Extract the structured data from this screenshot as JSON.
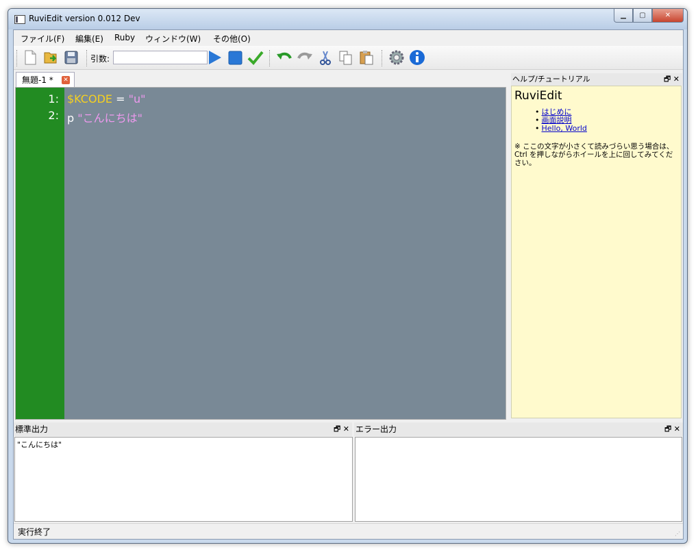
{
  "window": {
    "title": "RuviEdit version 0.012 Dev",
    "controls": {
      "minimize": "▁",
      "maximize": "▢",
      "close": "✕"
    }
  },
  "menu": {
    "items": [
      {
        "label": "ファイル(F)"
      },
      {
        "label": "編集(E)"
      },
      {
        "label": "Ruby"
      },
      {
        "label": "ウィンドウ(W)"
      },
      {
        "label": "その他(O)"
      }
    ]
  },
  "toolbar": {
    "buttons": [
      "new-file-icon",
      "open-folder-icon",
      "save-disk-icon",
      "run-play-icon",
      "stop-square-icon",
      "check-syntax-icon",
      "undo-icon",
      "redo-icon",
      "cut-scissors-icon",
      "copy-icon",
      "paste-icon",
      "settings-gear-icon",
      "info-icon"
    ],
    "args_label": "引数:",
    "args_value": ""
  },
  "editor": {
    "tab_label": "無題-1 *",
    "tab_close": "✕",
    "line_numbers": [
      "1:",
      "2:"
    ],
    "lines": [
      [
        {
          "text": "$KCODE",
          "kind": "var"
        },
        {
          "text": " = ",
          "kind": "op"
        },
        {
          "text": "\"u\"",
          "kind": "str"
        }
      ],
      [
        {
          "text": "p ",
          "kind": "op"
        },
        {
          "text": "\"こんにちは\"",
          "kind": "str"
        }
      ]
    ],
    "colors": {
      "background": "#798996",
      "gutter": "#228b22",
      "variable": "#f5d020",
      "string": "#ee99ee"
    }
  },
  "help": {
    "header": "ヘルプ/チュートリアル",
    "dock_float": "🗗",
    "dock_close": "✕",
    "title": "RuviEdit",
    "links": [
      "はじめに",
      "画面説明",
      "Hello, World"
    ],
    "note": "※ ここの文字が小さくて読みづらい思う場合は、Ctrl を押しながらホイールを上に回してみてください。"
  },
  "stdout": {
    "header": "標準出力",
    "dock_float": "🗗",
    "dock_close": "✕",
    "content": "\"こんにちは\""
  },
  "stderr": {
    "header": "エラー出力",
    "dock_float": "🗗",
    "dock_close": "✕",
    "content": ""
  },
  "status": {
    "text": "実行終了"
  }
}
